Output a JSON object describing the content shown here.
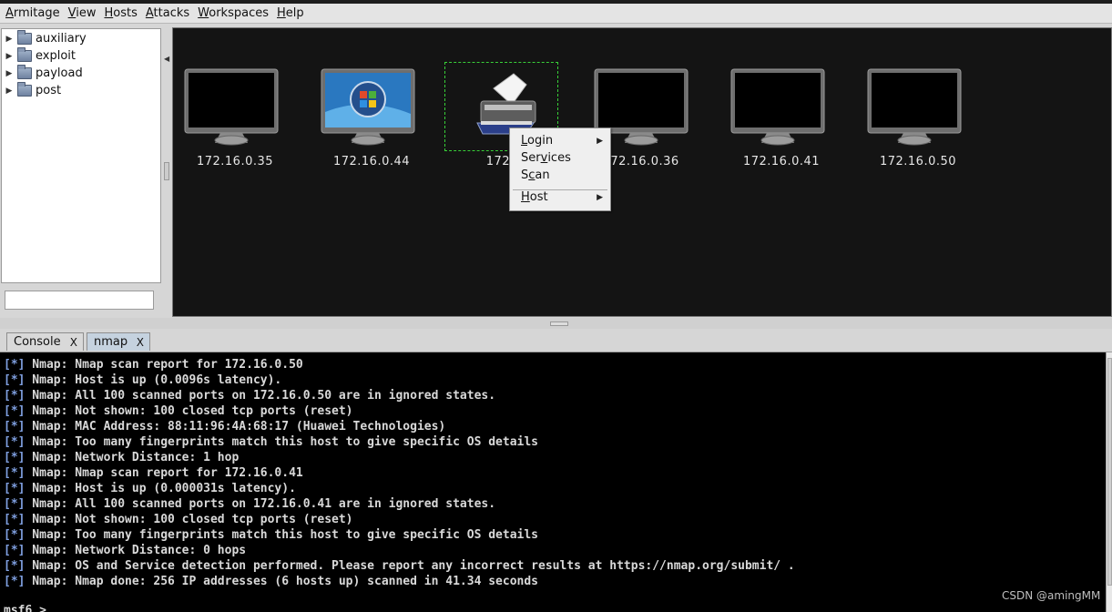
{
  "menubar": {
    "items": [
      {
        "accel": "A",
        "rest": "rmitage"
      },
      {
        "accel": "V",
        "rest": "iew"
      },
      {
        "accel": "H",
        "rest": "osts"
      },
      {
        "accel": "A",
        "rest": "ttacks"
      },
      {
        "accel": "W",
        "rest": "orkspaces"
      },
      {
        "accel": "H",
        "rest": "elp"
      }
    ]
  },
  "module_tree": {
    "items": [
      {
        "label": "auxiliary",
        "icon": "folder-icon"
      },
      {
        "label": "exploit",
        "icon": "folder-icon"
      },
      {
        "label": "payload",
        "icon": "folder-icon"
      },
      {
        "label": "post",
        "icon": "folder-icon"
      }
    ],
    "search_value": ""
  },
  "hosts": [
    {
      "ip": "172.16.0.35",
      "icon": "blank-monitor"
    },
    {
      "ip": "172.16.0.44",
      "icon": "windows-monitor"
    },
    {
      "ip": "172.16",
      "icon": "printer"
    },
    {
      "ip": "72.16.0.36",
      "icon": "blank-monitor"
    },
    {
      "ip": "172.16.0.41",
      "icon": "blank-monitor"
    },
    {
      "ip": "172.16.0.50",
      "icon": "blank-monitor"
    }
  ],
  "context_menu": {
    "login": {
      "before": "",
      "accel": "L",
      "after": "ogin"
    },
    "services": {
      "before": "Ser",
      "accel": "v",
      "after": "ices"
    },
    "scan": {
      "before": "S",
      "accel": "c",
      "after": "an"
    },
    "host": {
      "before": "",
      "accel": "H",
      "after": "ost"
    }
  },
  "tabs": [
    {
      "label": "Console",
      "close": "X"
    },
    {
      "label": "nmap",
      "close": "X"
    }
  ],
  "console": {
    "prefix": "[*]",
    "lines": [
      " Nmap: Nmap scan report for 172.16.0.50",
      " Nmap: Host is up (0.0096s latency).",
      " Nmap: All 100 scanned ports on 172.16.0.50 are in ignored states.",
      " Nmap: Not shown: 100 closed tcp ports (reset)",
      " Nmap: MAC Address: 88:11:96:4A:68:17 (Huawei Technologies)",
      " Nmap: Too many fingerprints match this host to give specific OS details",
      " Nmap: Network Distance: 1 hop",
      " Nmap: Nmap scan report for 172.16.0.41",
      " Nmap: Host is up (0.000031s latency).",
      " Nmap: All 100 scanned ports on 172.16.0.41 are in ignored states.",
      " Nmap: Not shown: 100 closed tcp ports (reset)",
      " Nmap: Too many fingerprints match this host to give specific OS details",
      " Nmap: Network Distance: 0 hops",
      " Nmap: OS and Service detection performed. Please report any incorrect results at https://nmap.org/submit/ .",
      " Nmap: Nmap done: 256 IP addresses (6 hosts up) scanned in 41.34 seconds"
    ],
    "prompt": "msf6 >"
  },
  "watermark": "CSDN @amingMM",
  "colors": {
    "console_bg": "#000000",
    "graph_bg": "#141414",
    "selection": "#38d038",
    "bracket": "#7f9fe0"
  }
}
